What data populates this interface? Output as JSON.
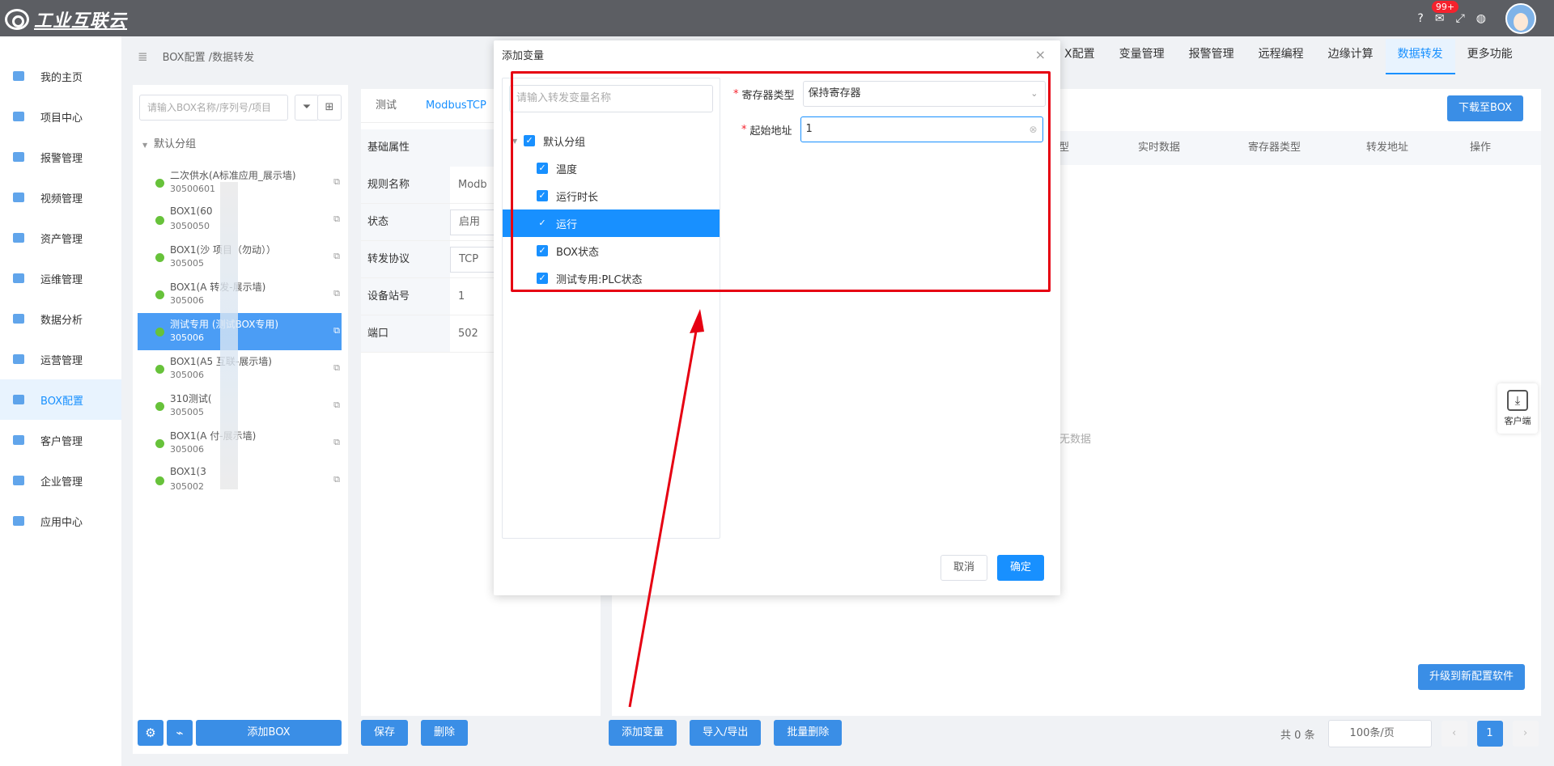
{
  "app": {
    "logo_text": "工业互联云"
  },
  "header": {
    "mail_badge": "99+",
    "icons": [
      "help-icon",
      "mail-icon",
      "fullscreen-icon",
      "language-icon"
    ]
  },
  "sidebar": {
    "items": [
      {
        "label": "我的主页"
      },
      {
        "label": "项目中心"
      },
      {
        "label": "报警管理"
      },
      {
        "label": "视频管理"
      },
      {
        "label": "资产管理"
      },
      {
        "label": "运维管理"
      },
      {
        "label": "数据分析"
      },
      {
        "label": "运营管理"
      },
      {
        "label": "BOX配置",
        "active": true
      },
      {
        "label": "客户管理"
      },
      {
        "label": "企业管理"
      },
      {
        "label": "应用中心"
      }
    ]
  },
  "breadcrumb": "BOX配置 /数据转发",
  "top_tabs": [
    "X配置",
    "变量管理",
    "报警管理",
    "远程编程",
    "边缘计算",
    "数据转发",
    "更多功能"
  ],
  "tree": {
    "search_placeholder": "请输入BOX名称/序列号/项目",
    "group": "默认分组",
    "items": [
      {
        "name": "二次供水(A标准应用_展示墙)",
        "sn": "30500601"
      },
      {
        "name": "BOX1(60",
        "sn": "3050050"
      },
      {
        "name": "BOX1(沙     项目（勿动））",
        "sn": "305005"
      },
      {
        "name": "BOX1(A      转发-展示墙)",
        "sn": "305006"
      },
      {
        "name": "测试专用      (测试BOX专用)",
        "sn": "305006"
      },
      {
        "name": "BOX1(A5     互联-展示墙)",
        "sn": "305006"
      },
      {
        "name": "310测试(",
        "sn": "305005"
      },
      {
        "name": "BOX1(A         付-展示墙)",
        "sn": "305006"
      },
      {
        "name": "BOX1(3",
        "sn": "305002"
      }
    ],
    "add_box": "添加BOX"
  },
  "middle": {
    "tabs": [
      "测试",
      "ModbusTCP"
    ],
    "section": "基础属性",
    "rows": [
      {
        "k": "规则名称",
        "v": "Modb"
      },
      {
        "k": "状态",
        "v": "启用"
      },
      {
        "k": "转发协议",
        "v": "TCP"
      },
      {
        "k": "设备站号",
        "v": "1"
      },
      {
        "k": "端口",
        "v": "502"
      }
    ],
    "save": "保存",
    "delete": "删除"
  },
  "right": {
    "download": "下载至BOX",
    "columns": [
      "型",
      "实时数据",
      "寄存器类型",
      "转发地址",
      "操作"
    ],
    "nodata": "暂无数据",
    "upgrade": "升级到新配置软件",
    "add_var": "添加变量",
    "import_export": "导入/导出",
    "batch_delete": "批量删除",
    "total": "共 0 条",
    "page_size": "100条/页",
    "page": "1",
    "client": "客户端"
  },
  "dialog": {
    "title": "添加变量",
    "search_placeholder": "请输入转发变量名称",
    "group": "默认分组",
    "vars": [
      "温度",
      "运行时长",
      "运行",
      "BOX状态",
      "测试专用:PLC状态"
    ],
    "register_label": "寄存器类型",
    "register_value": "保持寄存器",
    "start_label": "起始地址",
    "start_value": "1",
    "cancel": "取消",
    "ok": "确定"
  },
  "accent": "#1890ff",
  "annotation_color": "#e60012"
}
